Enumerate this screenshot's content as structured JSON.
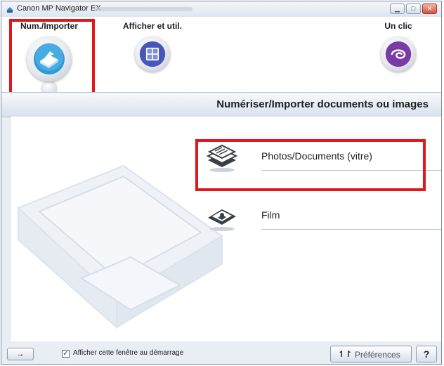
{
  "window": {
    "title": "Canon MP Navigator EX"
  },
  "toolbar": {
    "tools": [
      {
        "label": "Num./Importer",
        "icon": "scanner-icon",
        "selected": true
      },
      {
        "label": "Afficher et util.",
        "icon": "grid-view-icon",
        "selected": false
      },
      {
        "label": "Un clic",
        "icon": "one-click-icon",
        "selected": false
      }
    ]
  },
  "panel": {
    "title": "Numériser/Importer documents ou images",
    "options": [
      {
        "label": "Photos/Documents (vitre)",
        "icon": "documents-stack-icon",
        "highlighted": true
      },
      {
        "label": "Film",
        "icon": "film-icon",
        "highlighted": false
      }
    ]
  },
  "statusbar": {
    "nav_glyph": "→",
    "checkbox_label": "Afficher cette fenêtre au démarrage",
    "checkbox_checked": true,
    "checkbox_mark": "✓",
    "preferences_label": "Préférences",
    "preferences_icon_glyph": "↿↾",
    "help_label": "?"
  },
  "colors": {
    "highlight": "#e3161b",
    "accent_blue": "#2b9ad8",
    "accent_purple": "#7a3aa8"
  }
}
